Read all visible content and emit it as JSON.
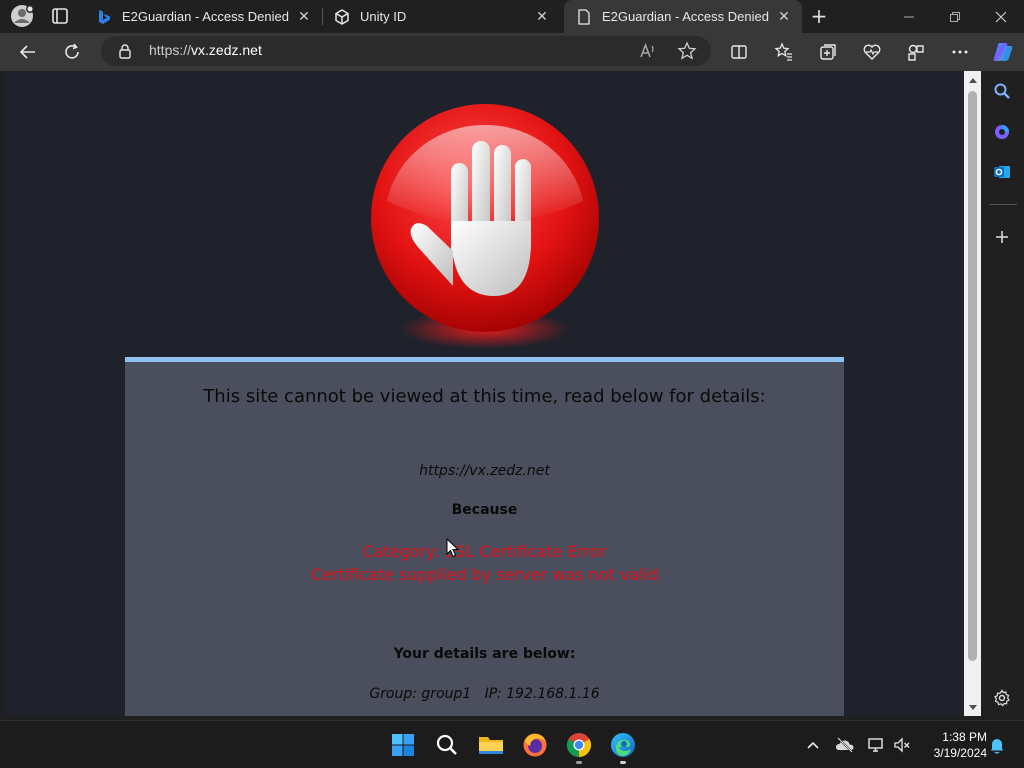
{
  "browser": {
    "tabs": [
      {
        "title": "E2Guardian - Access Denied",
        "favicon": "bing-icon",
        "active": false
      },
      {
        "title": "Unity ID",
        "favicon": "unity-icon",
        "active": false
      },
      {
        "title": "E2Guardian - Access Denied",
        "favicon": "page-icon",
        "active": true
      }
    ],
    "close_glyph": "✕",
    "new_tab_glyph": "+",
    "address": {
      "scheme": "https://",
      "host": "vx.zedz.net"
    }
  },
  "page": {
    "heading": "This site cannot be viewed at this time, read below for details:",
    "blocked_url": "https://vx.zedz.net",
    "because": "Because",
    "category": "Category: SSL Certificate Error",
    "reason": "Certificate supplied by server was not valid",
    "details_heading": "Your details are below:",
    "details": "Group: group1   IP: 192.168.1.16"
  },
  "taskbar": {
    "time": "1:38 PM",
    "date": "3/19/2024",
    "apps": [
      "start-icon",
      "search-icon",
      "file-explorer-icon",
      "firefox-icon",
      "chrome-icon",
      "edge-icon"
    ]
  },
  "colors": {
    "page_bg": "#1f222b",
    "panel_bg": "#4b4f5d",
    "panel_accent": "#8ec1f0",
    "error_red": "#e0141e"
  }
}
